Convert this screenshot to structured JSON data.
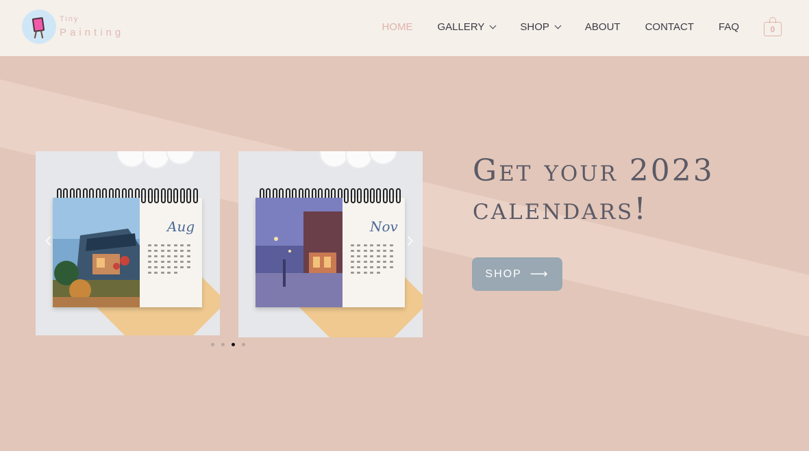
{
  "brand": {
    "small": "Tiny",
    "name": "Painting"
  },
  "nav": {
    "items": [
      {
        "label": "HOME",
        "active": true,
        "dropdown": false
      },
      {
        "label": "GALLERY",
        "dropdown": true
      },
      {
        "label": "SHOP",
        "dropdown": true
      },
      {
        "label": "ABOUT",
        "dropdown": false
      },
      {
        "label": "CONTACT",
        "dropdown": false
      },
      {
        "label": "FAQ",
        "dropdown": false
      }
    ],
    "cart_count": "0"
  },
  "hero": {
    "headline_line1": "Get your 2023",
    "headline_line2": "calendars!",
    "button_label": "SHOP",
    "button_icon": "long-arrow-right-icon"
  },
  "slider": {
    "slides": [
      {
        "month": "Aug"
      },
      {
        "month": "Nov"
      }
    ],
    "dots": 4,
    "active_dot": 3
  },
  "colors": {
    "header_bg": "#f5f0ea",
    "hero_bg": "#e2c6b9",
    "accent": "#e0b3ac",
    "button_bg": "#99a8b2",
    "headline": "#5b5a66"
  }
}
